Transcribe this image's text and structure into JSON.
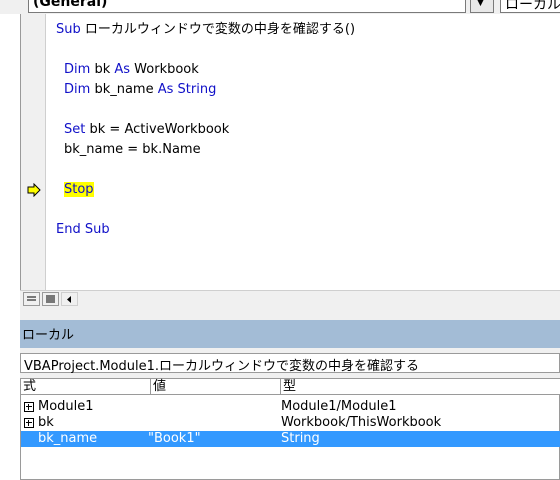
{
  "object_combo": {
    "value": "(General)"
  },
  "proc_combo": {
    "value": "ローカル"
  },
  "code": {
    "sub_kw": "Sub",
    "sub_name": "ローカルウィンドウで変数の中身を確認する()",
    "dim_kw": "Dim",
    "bk_var": "bk",
    "as_kw": "As",
    "workbook_type": "Workbook",
    "bk_name_var": "bk_name",
    "string_type": "String",
    "set_kw": "Set",
    "set_rest": "bk = ActiveWorkbook",
    "assign_line": "bk_name = bk.Name",
    "stop_kw": "Stop",
    "end_sub_kw": "End Sub"
  },
  "locals": {
    "title": "ローカル",
    "context": "VBAProject.Module1.ローカルウィンドウで変数の中身を確認する",
    "columns": [
      "式",
      "値",
      "型"
    ],
    "rows": [
      {
        "expression": "Module1",
        "value": "",
        "type": "Module1/Module1",
        "expandable": true,
        "selected": false
      },
      {
        "expression": "bk",
        "value": "",
        "type": "Workbook/ThisWorkbook",
        "expandable": true,
        "selected": false
      },
      {
        "expression": "bk_name",
        "value": "\"Book1\"",
        "type": "String",
        "expandable": false,
        "selected": true
      }
    ]
  },
  "colors": {
    "keyword": "#1010c8",
    "highlight": "#ffff00",
    "selection": "#3399ff",
    "title_bar": "#a3bcd6"
  },
  "icons": [
    "execution-arrow-icon",
    "procedure-view-icon",
    "full-module-view-icon",
    "scroll-left-icon",
    "expand-icon"
  ]
}
